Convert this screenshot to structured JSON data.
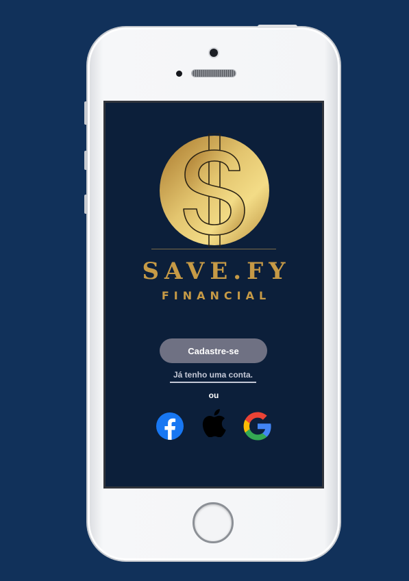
{
  "colors": {
    "background": "#11315a",
    "screen": "#0c1f3a",
    "gold": "#c69a46",
    "button": "#6f7183",
    "link": "#c4c8d6"
  },
  "brand": {
    "logo_icon": "dollar-coin-icon",
    "name": "SAVE.FY",
    "tagline": "FINANCIAL"
  },
  "actions": {
    "signup_label": "Cadastre-se",
    "login_label": "Já tenho uma conta.",
    "or_label": "ou"
  },
  "social_logins": [
    {
      "name": "facebook",
      "icon": "facebook-icon"
    },
    {
      "name": "apple",
      "icon": "apple-icon"
    },
    {
      "name": "google",
      "icon": "google-icon"
    }
  ]
}
